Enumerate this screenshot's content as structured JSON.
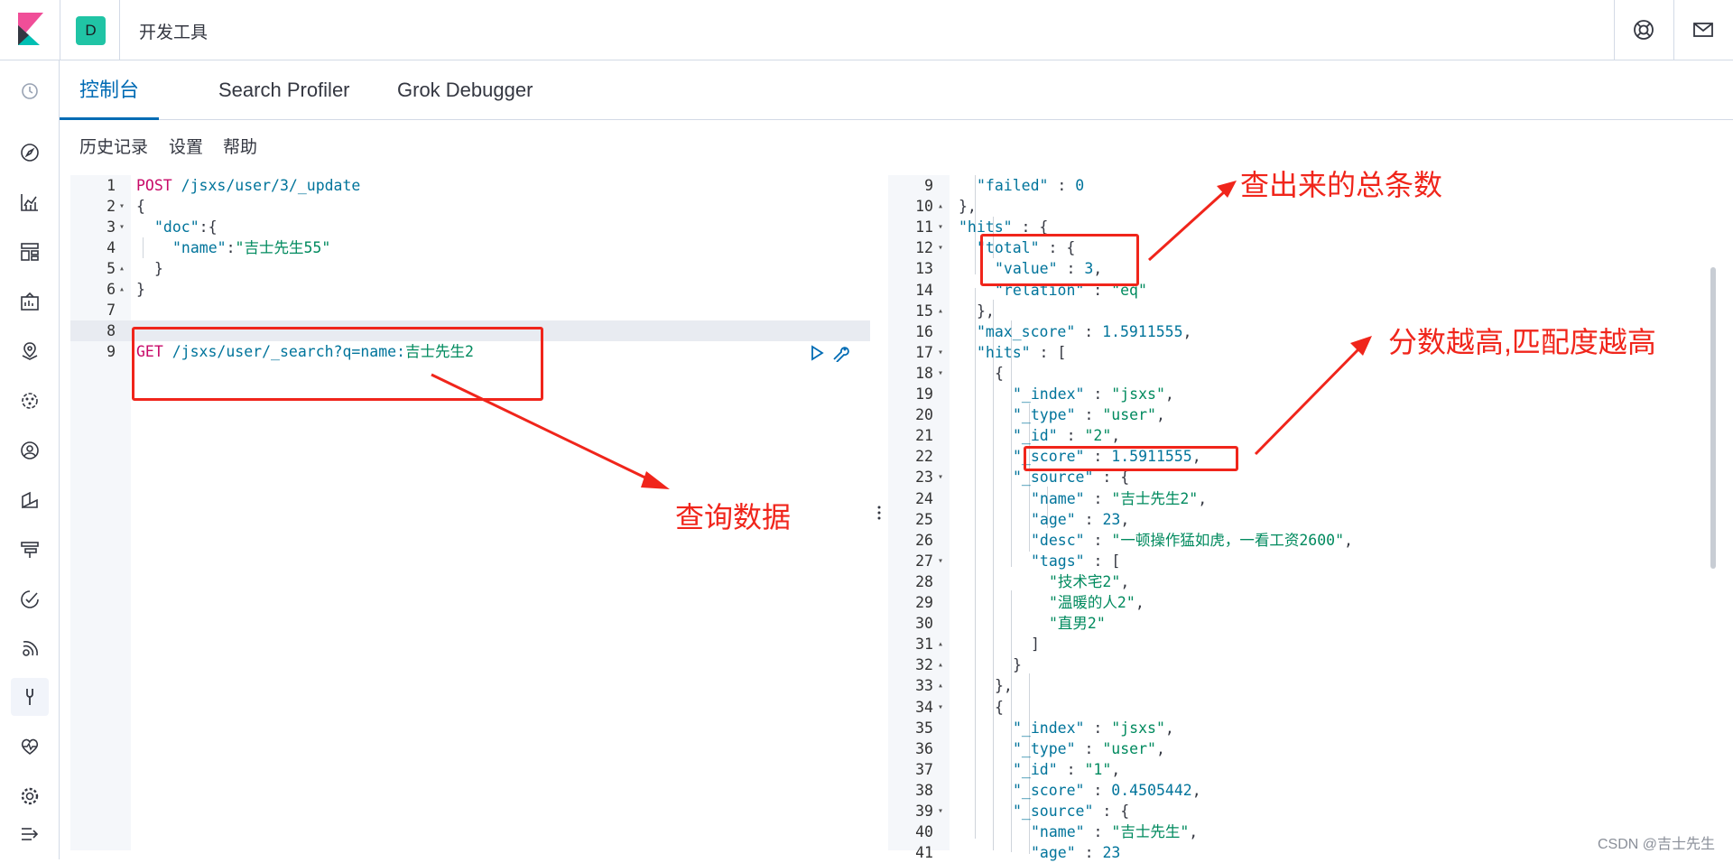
{
  "header": {
    "space_initial": "D",
    "app_title": "开发工具",
    "help_icon": "help-lifering-icon",
    "mail_icon": "mail-icon"
  },
  "tabs": [
    {
      "label": "控制台",
      "active": true
    },
    {
      "label": "Search Profiler",
      "active": false
    },
    {
      "label": "Grok Debugger",
      "active": false
    }
  ],
  "toolbar": {
    "history": "历史记录",
    "settings": "设置",
    "help": "帮助"
  },
  "request": {
    "lines": [
      {
        "n": "1",
        "fold": ""
      },
      {
        "n": "2",
        "fold": "▾"
      },
      {
        "n": "3",
        "fold": "▾"
      },
      {
        "n": "4",
        "fold": ""
      },
      {
        "n": "5",
        "fold": "▴"
      },
      {
        "n": "6",
        "fold": "▴"
      },
      {
        "n": "7",
        "fold": ""
      },
      {
        "n": "8",
        "fold": ""
      },
      {
        "n": "9",
        "fold": ""
      }
    ],
    "l1_method": "POST",
    "l1_url": " /jsxs/user/3/_update",
    "l2": "{",
    "l3_key": "\"doc\"",
    "l3_rest": ":{",
    "l4_key": "\"name\"",
    "l4_colon": ":",
    "l4_val": "\"吉士先生55\"",
    "l5": "}",
    "l6": "}",
    "l9_method": "GET",
    "l9_url": " /jsxs/user/_search?q=name:",
    "l9_query": "吉士先生2"
  },
  "response": {
    "lines": [
      {
        "n": "9",
        "fold": ""
      },
      {
        "n": "10",
        "fold": "▴"
      },
      {
        "n": "11",
        "fold": "▾"
      },
      {
        "n": "12",
        "fold": "▾"
      },
      {
        "n": "13",
        "fold": ""
      },
      {
        "n": "14",
        "fold": ""
      },
      {
        "n": "15",
        "fold": "▴"
      },
      {
        "n": "16",
        "fold": ""
      },
      {
        "n": "17",
        "fold": "▾"
      },
      {
        "n": "18",
        "fold": "▾"
      },
      {
        "n": "19",
        "fold": ""
      },
      {
        "n": "20",
        "fold": ""
      },
      {
        "n": "21",
        "fold": ""
      },
      {
        "n": "22",
        "fold": ""
      },
      {
        "n": "23",
        "fold": "▾"
      },
      {
        "n": "24",
        "fold": ""
      },
      {
        "n": "25",
        "fold": ""
      },
      {
        "n": "26",
        "fold": ""
      },
      {
        "n": "27",
        "fold": "▾"
      },
      {
        "n": "28",
        "fold": ""
      },
      {
        "n": "29",
        "fold": ""
      },
      {
        "n": "30",
        "fold": ""
      },
      {
        "n": "31",
        "fold": "▴"
      },
      {
        "n": "32",
        "fold": "▴"
      },
      {
        "n": "33",
        "fold": "▴"
      },
      {
        "n": "34",
        "fold": "▾"
      },
      {
        "n": "35",
        "fold": ""
      },
      {
        "n": "36",
        "fold": ""
      },
      {
        "n": "37",
        "fold": ""
      },
      {
        "n": "38",
        "fold": ""
      },
      {
        "n": "39",
        "fold": "▾"
      },
      {
        "n": "40",
        "fold": ""
      },
      {
        "n": "41",
        "fold": ""
      }
    ],
    "code": [
      {
        "indent": 1,
        "parts": [
          [
            "k",
            "\"failed\""
          ],
          [
            "p",
            " : "
          ],
          [
            "n",
            "0"
          ]
        ]
      },
      {
        "indent": 0,
        "parts": [
          [
            "p",
            "},"
          ]
        ]
      },
      {
        "indent": 0,
        "parts": [
          [
            "k",
            "\"hits\""
          ],
          [
            "p",
            " : {"
          ]
        ]
      },
      {
        "indent": 1,
        "parts": [
          [
            "k",
            "\"total\""
          ],
          [
            "p",
            " : {"
          ]
        ]
      },
      {
        "indent": 2,
        "parts": [
          [
            "k",
            "\"value\""
          ],
          [
            "p",
            " : "
          ],
          [
            "n",
            "3"
          ],
          [
            "p",
            ","
          ]
        ]
      },
      {
        "indent": 2,
        "parts": [
          [
            "k",
            "\"relation\""
          ],
          [
            "p",
            " : "
          ],
          [
            "s",
            "\"eq\""
          ]
        ]
      },
      {
        "indent": 1,
        "parts": [
          [
            "p",
            "},"
          ]
        ]
      },
      {
        "indent": 1,
        "parts": [
          [
            "k",
            "\"max_score\""
          ],
          [
            "p",
            " : "
          ],
          [
            "n",
            "1.5911555"
          ],
          [
            "p",
            ","
          ]
        ]
      },
      {
        "indent": 1,
        "parts": [
          [
            "k",
            "\"hits\""
          ],
          [
            "p",
            " : ["
          ]
        ]
      },
      {
        "indent": 2,
        "parts": [
          [
            "p",
            "{"
          ]
        ]
      },
      {
        "indent": 3,
        "parts": [
          [
            "k",
            "\"_index\""
          ],
          [
            "p",
            " : "
          ],
          [
            "s",
            "\"jsxs\""
          ],
          [
            "p",
            ","
          ]
        ]
      },
      {
        "indent": 3,
        "parts": [
          [
            "k",
            "\"_type\""
          ],
          [
            "p",
            " : "
          ],
          [
            "s",
            "\"user\""
          ],
          [
            "p",
            ","
          ]
        ]
      },
      {
        "indent": 3,
        "parts": [
          [
            "k",
            "\"_id\""
          ],
          [
            "p",
            " : "
          ],
          [
            "s",
            "\"2\""
          ],
          [
            "p",
            ","
          ]
        ]
      },
      {
        "indent": 3,
        "parts": [
          [
            "k",
            "\"_score\""
          ],
          [
            "p",
            " : "
          ],
          [
            "n",
            "1.5911555"
          ],
          [
            "p",
            ","
          ]
        ]
      },
      {
        "indent": 3,
        "parts": [
          [
            "k",
            "\"_source\""
          ],
          [
            "p",
            " : {"
          ]
        ]
      },
      {
        "indent": 4,
        "parts": [
          [
            "k",
            "\"name\""
          ],
          [
            "p",
            " : "
          ],
          [
            "s",
            "\"吉士先生2\""
          ],
          [
            "p",
            ","
          ]
        ]
      },
      {
        "indent": 4,
        "parts": [
          [
            "k",
            "\"age\""
          ],
          [
            "p",
            " : "
          ],
          [
            "n",
            "23"
          ],
          [
            "p",
            ","
          ]
        ]
      },
      {
        "indent": 4,
        "parts": [
          [
            "k",
            "\"desc\""
          ],
          [
            "p",
            " : "
          ],
          [
            "s",
            "\"一顿操作猛如虎，一看工资2600\""
          ],
          [
            "p",
            ","
          ]
        ]
      },
      {
        "indent": 4,
        "parts": [
          [
            "k",
            "\"tags\""
          ],
          [
            "p",
            " : ["
          ]
        ]
      },
      {
        "indent": 5,
        "parts": [
          [
            "s",
            "\"技术宅2\""
          ],
          [
            "p",
            ","
          ]
        ]
      },
      {
        "indent": 5,
        "parts": [
          [
            "s",
            "\"温暖的人2\""
          ],
          [
            "p",
            ","
          ]
        ]
      },
      {
        "indent": 5,
        "parts": [
          [
            "s",
            "\"直男2\""
          ]
        ]
      },
      {
        "indent": 4,
        "parts": [
          [
            "p",
            "]"
          ]
        ]
      },
      {
        "indent": 3,
        "parts": [
          [
            "p",
            "}"
          ]
        ]
      },
      {
        "indent": 2,
        "parts": [
          [
            "p",
            "},"
          ]
        ]
      },
      {
        "indent": 2,
        "parts": [
          [
            "p",
            "{"
          ]
        ]
      },
      {
        "indent": 3,
        "parts": [
          [
            "k",
            "\"_index\""
          ],
          [
            "p",
            " : "
          ],
          [
            "s",
            "\"jsxs\""
          ],
          [
            "p",
            ","
          ]
        ]
      },
      {
        "indent": 3,
        "parts": [
          [
            "k",
            "\"_type\""
          ],
          [
            "p",
            " : "
          ],
          [
            "s",
            "\"user\""
          ],
          [
            "p",
            ","
          ]
        ]
      },
      {
        "indent": 3,
        "parts": [
          [
            "k",
            "\"_id\""
          ],
          [
            "p",
            " : "
          ],
          [
            "s",
            "\"1\""
          ],
          [
            "p",
            ","
          ]
        ]
      },
      {
        "indent": 3,
        "parts": [
          [
            "k",
            "\"_score\""
          ],
          [
            "p",
            " : "
          ],
          [
            "n",
            "0.4505442"
          ],
          [
            "p",
            ","
          ]
        ]
      },
      {
        "indent": 3,
        "parts": [
          [
            "k",
            "\"_source\""
          ],
          [
            "p",
            " : {"
          ]
        ]
      },
      {
        "indent": 4,
        "parts": [
          [
            "k",
            "\"name\""
          ],
          [
            "p",
            " : "
          ],
          [
            "s",
            "\"吉士先生\""
          ],
          [
            "p",
            ","
          ]
        ]
      },
      {
        "indent": 4,
        "parts": [
          [
            "k",
            "\"age\""
          ],
          [
            "p",
            " : "
          ],
          [
            "n",
            "23"
          ]
        ]
      }
    ]
  },
  "annotations": {
    "query": "查询数据",
    "total": "查出来的总条数",
    "score": "分数越高,匹配度越高",
    "color": "#f0251b"
  },
  "watermark": "CSDN @吉士先生",
  "colors": {
    "accent": "#006bb4",
    "badge": "#20c4a5"
  }
}
